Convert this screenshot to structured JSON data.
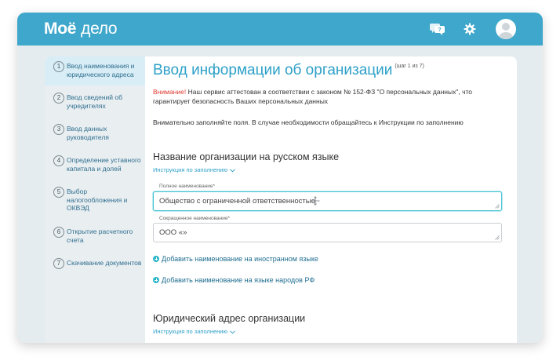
{
  "header": {
    "logo_part1": "Моё",
    "logo_part2": "дело",
    "icons": [
      "help-chat-icon",
      "gear-icon",
      "avatar-icon"
    ]
  },
  "sidebar": {
    "steps": [
      {
        "num": "1",
        "label": "Ввод наименования и юридического адреса"
      },
      {
        "num": "2",
        "label": "Ввод сведений об учредителях"
      },
      {
        "num": "3",
        "label": "Ввод данных руководителя"
      },
      {
        "num": "4",
        "label": "Определение уставного капитала и долей"
      },
      {
        "num": "5",
        "label": "Выбор налогообложения и ОКВЭД"
      },
      {
        "num": "6",
        "label": "Открытие расчетного счета"
      },
      {
        "num": "7",
        "label": "Скачивание документов"
      }
    ]
  },
  "main": {
    "title": "Ввод информации об организации",
    "step_note": "(шаг 1 из 7)",
    "warning_word": "Внимание!",
    "warning_text": " Наш сервис аттестован в соответствии с законом № 152-ФЗ \"О персональных данных\", что гарантирует безопасность Ваших персональных данных",
    "notice": "Внимательно заполняйте поля. В случае необходимости обращайтесь к Инструкции по заполнению",
    "section1_title": "Название организации на русском языке",
    "guide_link": "Инструкция по заполнению",
    "full_name_label": "Полное наименование*",
    "full_name_value": "Общество с ограниченной ответственностью",
    "short_name_label": "Сокращенное наименование*",
    "short_name_value": "ООО «»",
    "add_foreign": "Добавить наименование на иностранном языке",
    "add_native": "Добавить наименование на языке народов РФ",
    "section2_title": "Юридический адрес организации",
    "guide_link2": "Инструкция по заполнению"
  },
  "colors": {
    "header": "#3fa7cb",
    "accent": "#2ea0c8",
    "warning": "#e03b32",
    "focus": "#46c3d4"
  }
}
